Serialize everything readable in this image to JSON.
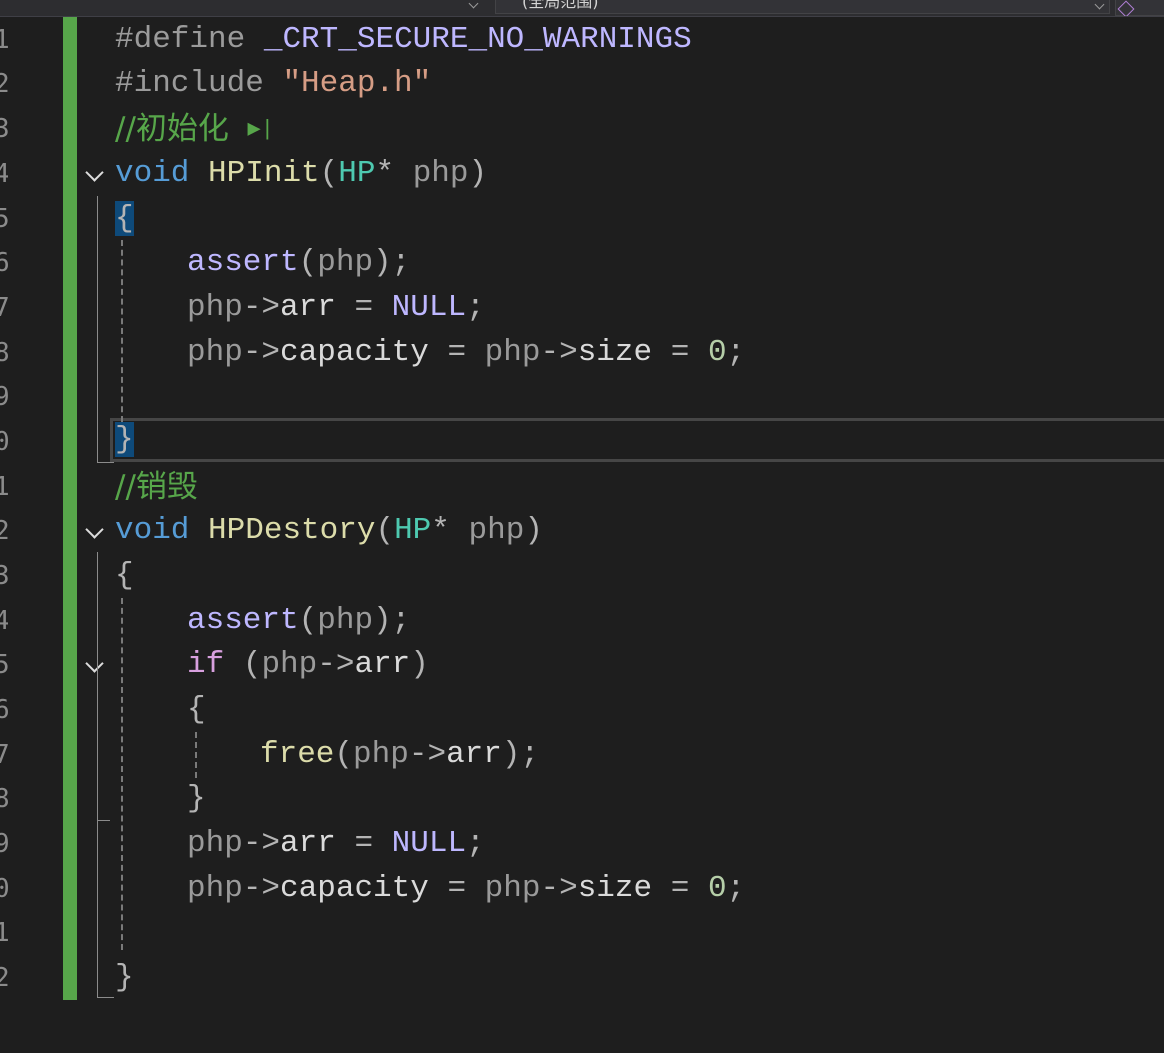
{
  "toolbar": {
    "scope_dropdown_label": "(全局范围)"
  },
  "gutter": {
    "line_numbers": [
      "1",
      "2",
      "3",
      "4",
      "5",
      "6",
      "7",
      "8",
      "9",
      "0",
      "1",
      "2",
      "3",
      "4",
      "5",
      "6",
      "7",
      "8",
      "9",
      "0",
      "1",
      "2"
    ]
  },
  "code": {
    "l1": {
      "directive": "#define",
      "name": "_CRT_SECURE_NO_WARNINGS"
    },
    "l2": {
      "directive": "#include",
      "path": "\"Heap.h\""
    },
    "l3": {
      "comment": "//初始化",
      "run_glyph": "▶|"
    },
    "l4": {
      "kw": "void",
      "fn": "HPInit",
      "lp": "(",
      "type": "HP",
      "ptr": "*",
      "param": "php",
      "rp": ")"
    },
    "l5": {
      "brace": "{"
    },
    "l6": {
      "fn": "assert",
      "lp": "(",
      "param": "php",
      "rp": ")",
      "semi": ";"
    },
    "l7": {
      "param": "php",
      "arrow": "->",
      "field": "arr",
      "eq": " = ",
      "macro": "NULL",
      "semi": ";"
    },
    "l8": {
      "param1": "php",
      "arrow1": "->",
      "field1": "capacity",
      "eq1": " = ",
      "param2": "php",
      "arrow2": "->",
      "field2": "size",
      "eq2": " = ",
      "num": "0",
      "semi": ";"
    },
    "l10": {
      "brace": "}"
    },
    "l11": {
      "comment": "//销毁"
    },
    "l12": {
      "kw": "void",
      "fn": "HPDestory",
      "lp": "(",
      "type": "HP",
      "ptr": "*",
      "param": "php",
      "rp": ")"
    },
    "l13": {
      "brace": "{"
    },
    "l14": {
      "fn": "assert",
      "lp": "(",
      "param": "php",
      "rp": ")",
      "semi": ";"
    },
    "l15": {
      "kw": "if",
      "lp": " (",
      "param": "php",
      "arrow": "->",
      "field": "arr",
      "rp": ")"
    },
    "l16": {
      "brace": "{"
    },
    "l17": {
      "fn": "free",
      "lp": "(",
      "param": "php",
      "arrow": "->",
      "field": "arr",
      "rp": ")",
      "semi": ";"
    },
    "l18": {
      "brace": "}"
    },
    "l19": {
      "param": "php",
      "arrow": "->",
      "field": "arr",
      "eq": " = ",
      "macro": "NULL",
      "semi": ";"
    },
    "l20": {
      "param1": "php",
      "arrow1": "->",
      "field1": "capacity",
      "eq1": " = ",
      "param2": "php",
      "arrow2": "->",
      "field2": "size",
      "eq2": " = ",
      "num": "0",
      "semi": ";"
    },
    "l22": {
      "brace": "}"
    }
  }
}
